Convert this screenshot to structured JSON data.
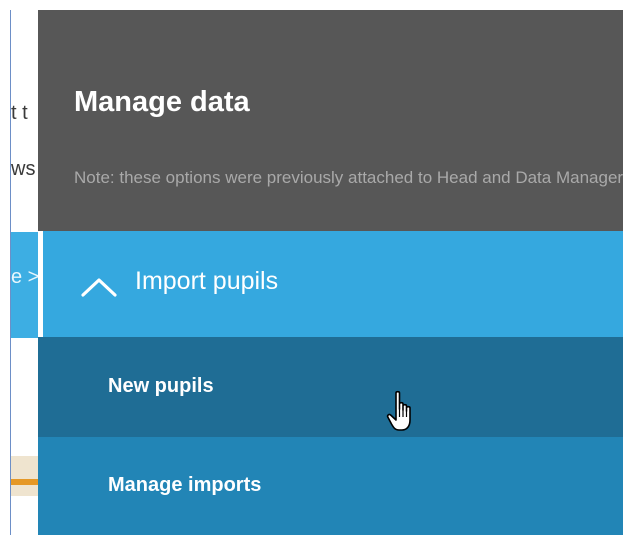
{
  "background": {
    "fragment_1": "t t",
    "fragment_2": "ws",
    "fragment_3": "e >"
  },
  "panel": {
    "title": "Manage data",
    "note": "Note: these options were previously attached to Head and Data Managers.",
    "section": {
      "label": "Import pupils",
      "expanded": true,
      "icon": "chevron-up-icon"
    },
    "items": [
      {
        "label": "New pupils"
      },
      {
        "label": "Manage imports"
      }
    ]
  },
  "colors": {
    "panel_bg": "#575757",
    "section_header": "#35a8df",
    "item_hover": "#1f6d95",
    "item": "#2285b6"
  },
  "cursor": "pointer-hand-icon"
}
